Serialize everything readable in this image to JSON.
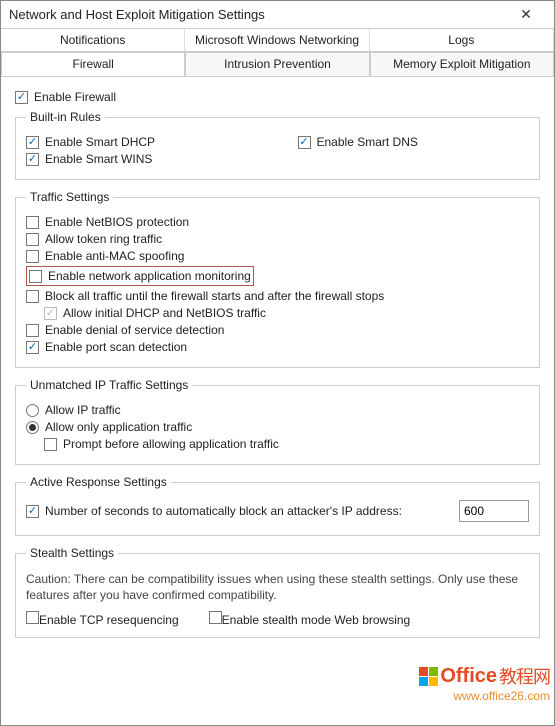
{
  "title": "Network and Host Exploit Mitigation Settings",
  "tabs_row1": {
    "t0": "Notifications",
    "t1": "Microsoft Windows Networking",
    "t2": "Logs"
  },
  "tabs_row2": {
    "t0": "Firewall",
    "t1": "Intrusion Prevention",
    "t2": "Memory Exploit Mitigation"
  },
  "enable_firewall": "Enable Firewall",
  "builtin": {
    "legend": "Built-in Rules",
    "dhcp": "Enable Smart DHCP",
    "dns": "Enable Smart DNS",
    "wins": "Enable Smart WINS"
  },
  "traffic": {
    "legend": "Traffic Settings",
    "netbios": "Enable NetBIOS protection",
    "tokenring": "Allow token ring traffic",
    "antimac": "Enable anti-MAC spoofing",
    "netapp": "Enable network application monitoring",
    "blockall": "Block all traffic until the firewall starts and after the firewall stops",
    "allowinitial": "Allow initial DHCP and NetBIOS traffic",
    "dos": "Enable denial of service detection",
    "portscan": "Enable port scan detection"
  },
  "unmatched": {
    "legend": "Unmatched IP Traffic Settings",
    "allowip": "Allow IP traffic",
    "allowapp": "Allow only application traffic",
    "prompt": "Prompt before allowing application traffic"
  },
  "active": {
    "legend": "Active Response Settings",
    "seconds_label": "Number of seconds to automatically block an attacker's IP address:",
    "seconds_value": "600"
  },
  "stealth": {
    "legend": "Stealth Settings",
    "caption": "Caution: There can be compatibility issues when using these stealth settings. Only use these features after you have confirmed compatibility.",
    "tcp": "Enable TCP resequencing",
    "browsing": "Enable stealth mode Web browsing"
  },
  "watermark": {
    "brand": "Office",
    "suffix": "教程网",
    "url": "www.office26.com"
  }
}
